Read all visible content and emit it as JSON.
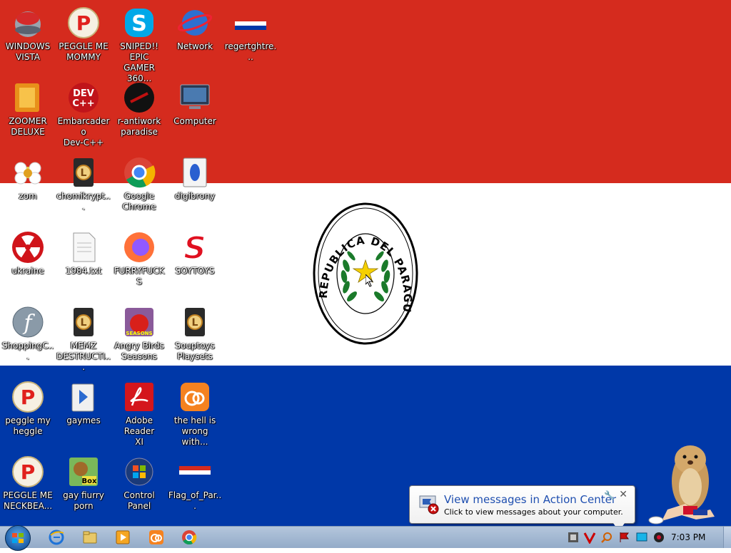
{
  "desktop": {
    "seal_text": "REPUBLICA DEL PARAGUAY",
    "colors": {
      "red": "#d52b1e",
      "white": "#ffffff",
      "blue": "#0038a8"
    },
    "icons": [
      {
        "label": "WINDOWS\nVISTA",
        "icon": "vista-app-icon"
      },
      {
        "label": "PEGGLE ME\nMOMMY",
        "icon": "peggle-icon"
      },
      {
        "label": "SNIPED!! EPIC\nGAMER 360...",
        "icon": "skype-icon"
      },
      {
        "label": "Network",
        "icon": "network-icon"
      },
      {
        "label": "regertghtre...",
        "icon": "flag-file-icon"
      },
      {
        "label": "ZOOMER\nDELUXE",
        "icon": "zoomer-icon"
      },
      {
        "label": "Embarcadero\nDev-C++",
        "icon": "devcpp-icon"
      },
      {
        "label": "r-antiwork\nparadise",
        "icon": "antiwork-icon"
      },
      {
        "label": "Computer",
        "icon": "computer-icon"
      },
      {
        "label": "zom",
        "icon": "flower-icon"
      },
      {
        "label": "chomikrypt...",
        "icon": "shortcut-l-icon"
      },
      {
        "label": "Google\nChrome",
        "icon": "chrome-icon"
      },
      {
        "label": "digibrony",
        "icon": "digibrony-icon"
      },
      {
        "label": "ukraine",
        "icon": "radiation-icon"
      },
      {
        "label": "1984.txt",
        "icon": "text-file-icon"
      },
      {
        "label": "FURRYFUCKS",
        "icon": "firefox-icon"
      },
      {
        "label": "SOYTOYS",
        "icon": "soytoys-icon"
      },
      {
        "label": "ShoppingC...",
        "icon": "flash-icon"
      },
      {
        "label": "MEMZ\nDESTRUCTI...",
        "icon": "shortcut-l-icon"
      },
      {
        "label": "Angry Birds\nSeasons",
        "icon": "angry-birds-icon"
      },
      {
        "label": "Souptoys\nPlaysets",
        "icon": "shortcut-l-icon"
      },
      {
        "label": "peggle my\nheggle",
        "icon": "peggle-icon"
      },
      {
        "label": "gaymes",
        "icon": "games-folder-icon"
      },
      {
        "label": "Adobe Reader\nXI",
        "icon": "adobe-reader-icon"
      },
      {
        "label": "the hell is\nwrong with...",
        "icon": "uc-browser-icon"
      },
      {
        "label": "PEGGLE ME\nNECKBEA...",
        "icon": "peggle-icon"
      },
      {
        "label": "gay fiurry\nporn",
        "icon": "box-game-icon"
      },
      {
        "label": "Control Panel",
        "icon": "control-panel-icon"
      },
      {
        "label": "Flag_of_Par...",
        "icon": "flag-file-icon"
      }
    ]
  },
  "notification": {
    "title": "View messages in Action Center",
    "text": "Click to view messages about your computer.",
    "close": "✕",
    "wrench": "🔧"
  },
  "taskbar": {
    "clock": "7:03 PM",
    "pinned": [
      "ie-icon",
      "explorer-icon",
      "media-player-icon",
      "uc-browser-icon",
      "chrome-icon"
    ],
    "tray": [
      "tray-app-icon",
      "tray-v-icon",
      "tray-search-icon",
      "action-center-flag-icon",
      "tray-display-icon",
      "tray-speaker-icon"
    ]
  }
}
